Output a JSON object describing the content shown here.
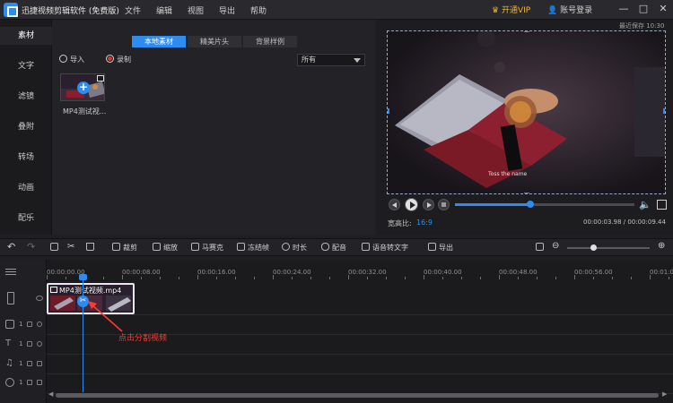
{
  "app": {
    "title": "迅捷视频剪辑软件 (免费版)"
  },
  "menu": [
    "文件",
    "编辑",
    "视图",
    "导出",
    "帮助"
  ],
  "account": {
    "vip": "开通VIP",
    "login": "账号登录"
  },
  "window_controls": {
    "minimize": "—",
    "maximize": "□",
    "close": "✕"
  },
  "sidebar": {
    "items": [
      "素材",
      "文字",
      "滤镜",
      "叠附",
      "转场",
      "动画",
      "配乐"
    ],
    "active_index": 0
  },
  "library": {
    "tabs": [
      "本地素材",
      "精美片头",
      "背景样例"
    ],
    "active_tab": 0,
    "import_label": "导入",
    "record_label": "录制",
    "filter_value": "所有",
    "media": [
      {
        "name": "MP4测试视..."
      }
    ]
  },
  "preview": {
    "last_saved": "最近保存 10:30",
    "subtitle": "Toss the name",
    "aspect_label": "宽高比:",
    "aspect_value": "16:9",
    "timecode": "00:00:03.98 / 00:00:09.44",
    "progress": 0.42,
    "volume_icon": "speaker-icon",
    "fullscreen_icon": "fullscreen-icon"
  },
  "toolbar": {
    "tools": [
      "裁剪",
      "缩放",
      "马赛克",
      "冻结帧",
      "时长",
      "配音",
      "语音转文字",
      "导出"
    ]
  },
  "timeline": {
    "ticks": [
      "00:00:00.00",
      "00:00:08.00",
      "00:00:16.00",
      "00:00:24.00",
      "00:00:32.00",
      "00:00:40.00",
      "00:00:48.00",
      "00:00:56.00",
      "00:01:0"
    ],
    "clip_name": "MP4测试视频.mp4",
    "track_numbers": [
      "1",
      "1",
      "1",
      "1"
    ],
    "annotation": "点击分割视频",
    "playhead_time": "00:00:03.98"
  },
  "colors": {
    "accent": "#2c8cf0",
    "annotation": "#ff3b30",
    "vip": "#f0b429"
  }
}
